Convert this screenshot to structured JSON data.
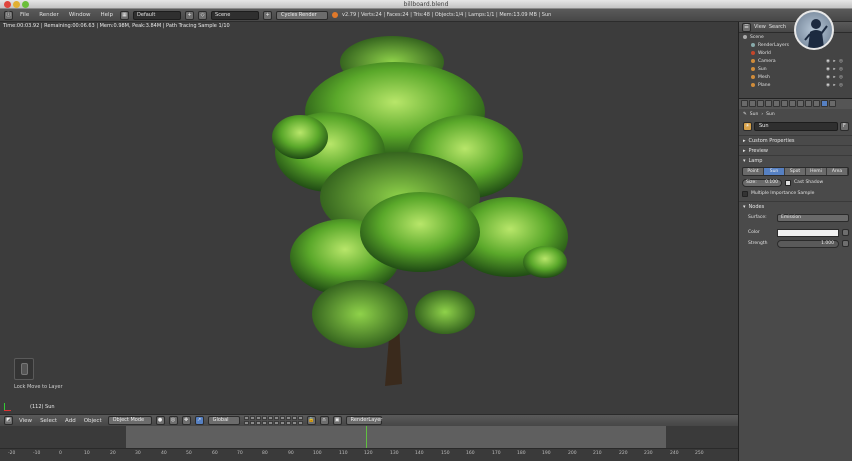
{
  "window": {
    "title": "billboard.blend"
  },
  "info_header": {
    "menus": [
      "File",
      "Render",
      "Window",
      "Help"
    ],
    "screen_layout": "Default",
    "scene": "Scene",
    "render_engine": "Cycles Render",
    "stats": "v2.79 | Verts:24 | Faces:24 | Tris:48 | Objects:1/4 | Lamps:1/1 | Mem:13.09 MB | Sun"
  },
  "viewport": {
    "status": "Time:00:03.92 | Remaining:00:06.63 | Mem:0.98M, Peak:3.84M | Path Tracing Sample 1/10",
    "hint": "Lock Move to Layer",
    "object_label": "(112) Sun"
  },
  "view_header": {
    "menus": [
      "View",
      "Select",
      "Add",
      "Object"
    ],
    "mode": "Object Mode",
    "orientation": "Global",
    "render_layer": "RenderLayer"
  },
  "timeline": {
    "ticks": [
      "-20",
      "-10",
      "0",
      "10",
      "20",
      "30",
      "40",
      "50",
      "60",
      "70",
      "80",
      "90",
      "100",
      "110",
      "120",
      "130",
      "140",
      "150",
      "160",
      "170",
      "180",
      "190",
      "200",
      "210",
      "220",
      "230",
      "240",
      "250"
    ]
  },
  "outliner": {
    "menus": [
      "View",
      "Search"
    ],
    "rows": [
      "Scene",
      "RenderLayers",
      "World",
      "Camera",
      "Sun",
      "Mesh",
      "Plane"
    ]
  },
  "properties": {
    "breadcrumb": [
      "Sun",
      "Sun"
    ],
    "datablock_name": "Sun",
    "panels": {
      "custom_properties": "Custom Properties",
      "preview": "Preview",
      "lamp": "Lamp",
      "nodes": "Nodes"
    },
    "lamp_types": [
      "Point",
      "Sun",
      "Spot",
      "Hemi",
      "Area"
    ],
    "active_lamp_type": "Sun",
    "size_label": "Size:",
    "size_value": "0.100",
    "cast_shadow": "Cast Shadow",
    "multiple_importance": "Multiple Importance Sample",
    "surface_label": "Surface:",
    "surface_value": "Emission",
    "color_label": "Color",
    "strength_label": "Strength",
    "strength_value": "1.000"
  }
}
